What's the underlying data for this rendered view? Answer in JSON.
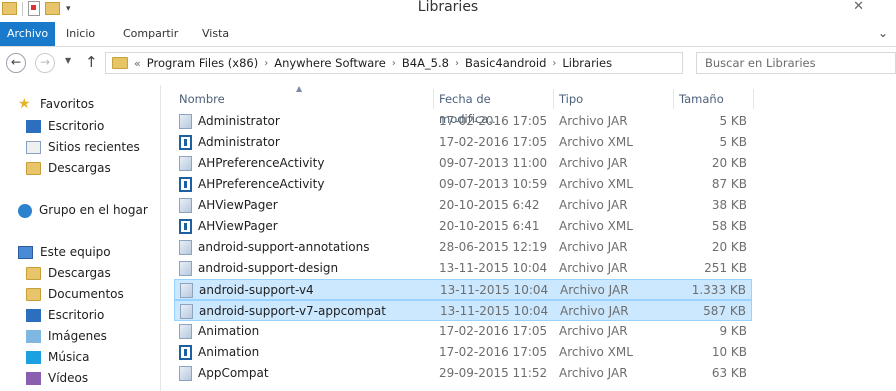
{
  "window": {
    "title": "Libraries"
  },
  "ribbon": {
    "tabs": [
      "Archivo",
      "Inicio",
      "Compartir",
      "Vista"
    ]
  },
  "address": {
    "crumbs": [
      "Program Files (x86)",
      "Anywhere Software",
      "B4A_5.8",
      "Basic4android",
      "Libraries"
    ],
    "search_placeholder": "Buscar en Libraries"
  },
  "nav": {
    "favorites": {
      "label": "Favoritos",
      "items": [
        "Escritorio",
        "Sitios recientes",
        "Descargas"
      ]
    },
    "homegroup": "Grupo en el hogar",
    "thispc": {
      "label": "Este equipo",
      "items": [
        "Descargas",
        "Documentos",
        "Escritorio",
        "Imágenes",
        "Música",
        "Vídeos"
      ]
    }
  },
  "columns": [
    "Nombre",
    "Fecha de modifica...",
    "Tipo",
    "Tamaño"
  ],
  "files": [
    {
      "name": "Administrator",
      "date": "17-02-2016 17:05",
      "type": "Archivo JAR",
      "size": "5 KB",
      "icon": "jar-file-icon"
    },
    {
      "name": "Administrator",
      "date": "17-02-2016 17:05",
      "type": "Archivo XML",
      "size": "5 KB",
      "icon": "xml-file-icon"
    },
    {
      "name": "AHPreferenceActivity",
      "date": "09-07-2013 11:00",
      "type": "Archivo JAR",
      "size": "20 KB",
      "icon": "jar-file-icon"
    },
    {
      "name": "AHPreferenceActivity",
      "date": "09-07-2013 10:59",
      "type": "Archivo XML",
      "size": "87 KB",
      "icon": "xml-file-icon"
    },
    {
      "name": "AHViewPager",
      "date": "20-10-2015 6:42",
      "type": "Archivo JAR",
      "size": "38 KB",
      "icon": "jar-file-icon"
    },
    {
      "name": "AHViewPager",
      "date": "20-10-2015 6:41",
      "type": "Archivo XML",
      "size": "58 KB",
      "icon": "xml-file-icon"
    },
    {
      "name": "android-support-annotations",
      "date": "28-06-2015 12:19",
      "type": "Archivo JAR",
      "size": "20 KB",
      "icon": "jar-file-icon"
    },
    {
      "name": "android-support-design",
      "date": "13-11-2015 10:04",
      "type": "Archivo JAR",
      "size": "251 KB",
      "icon": "jar-file-icon"
    },
    {
      "name": "android-support-v4",
      "date": "13-11-2015 10:04",
      "type": "Archivo JAR",
      "size": "1.333 KB",
      "icon": "jar-file-icon",
      "selected": true
    },
    {
      "name": "android-support-v7-appcompat",
      "date": "13-11-2015 10:04",
      "type": "Archivo JAR",
      "size": "587 KB",
      "icon": "jar-file-icon",
      "selected": true
    },
    {
      "name": "Animation",
      "date": "17-02-2016 17:05",
      "type": "Archivo JAR",
      "size": "9 KB",
      "icon": "jar-file-icon"
    },
    {
      "name": "Animation",
      "date": "17-02-2016 17:05",
      "type": "Archivo XML",
      "size": "10 KB",
      "icon": "xml-file-icon"
    },
    {
      "name": "AppCompat",
      "date": "29-09-2015 11:52",
      "type": "Archivo JAR",
      "size": "63 KB",
      "icon": "jar-file-icon"
    }
  ],
  "colors": {
    "accent": "#1979ca",
    "selection": "#cce8ff",
    "selection_border": "#99d1ff"
  }
}
